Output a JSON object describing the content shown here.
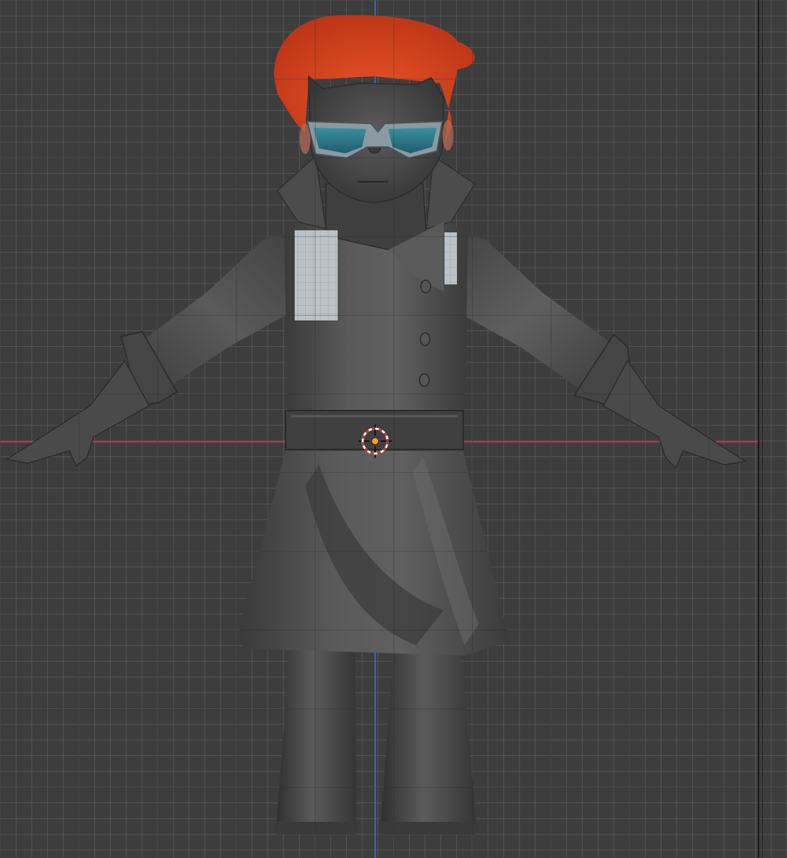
{
  "viewport": {
    "name": "3D Viewport",
    "view": "Front Orthographic",
    "grid": true
  },
  "axes": {
    "x_axis_color": "#c8404a",
    "z_axis_color": "#3d7ad8"
  },
  "colors": {
    "background": "#3d3d3d",
    "grid_line": "#5a5a5a",
    "mesh_base": "#4f4f4f",
    "mesh_dark": "#2e2e2e",
    "mesh_light": "#6b6b6b",
    "hair": "#d9441f",
    "goggle_frame": "#8a9aa0",
    "goggle_lens": "#2a7a8c",
    "texture_patch": "#c9d0d6",
    "cursor_ring_red": "#d42a2a",
    "cursor_ring_white": "#ffffff",
    "origin_dot": "#ff9c2a"
  },
  "scene": {
    "object": "character-mesh",
    "icons": [
      "3d-cursor-icon",
      "origin-dot-icon"
    ]
  }
}
